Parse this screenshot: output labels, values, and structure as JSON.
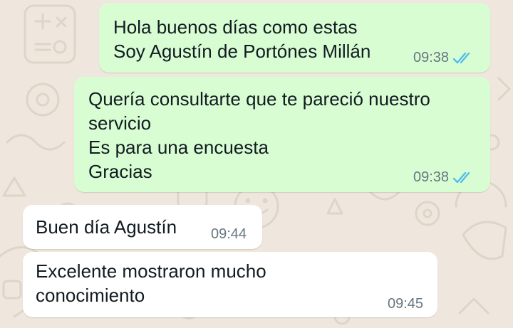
{
  "chat": {
    "accent_tick_color": "#53bdeb",
    "outgoing_bubble_color": "#d9fdd3",
    "incoming_bubble_color": "#ffffff",
    "messages": [
      {
        "direction": "outgoing",
        "lines": [
          "Hola buenos días como estas",
          "Soy Agustín de Portónes Millán"
        ],
        "time": "09:38",
        "status": "read"
      },
      {
        "direction": "outgoing",
        "lines": [
          "Quería consultarte que te pareció nuestro",
          "servicio",
          "Es para una encuesta",
          "Gracias"
        ],
        "time": "09:38",
        "status": "read"
      },
      {
        "direction": "incoming",
        "lines": [
          "Buen día Agustín"
        ],
        "time": "09:44"
      },
      {
        "direction": "incoming",
        "lines": [
          "Excelente mostraron mucho",
          "conocimiento"
        ],
        "time": "09:45"
      }
    ]
  }
}
